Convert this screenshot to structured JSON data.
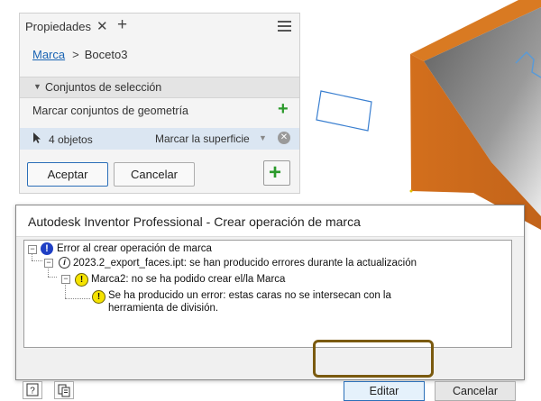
{
  "properties_panel": {
    "tab_label": "Propiedades",
    "breadcrumb": {
      "link": "Marca",
      "current": "Boceto3"
    },
    "section_title": "Conjuntos de selección",
    "mark_geometry_label": "Marcar conjuntos de geometría",
    "selection": {
      "count": "4 objetos",
      "mode": "Marcar la superficie"
    },
    "ok_label": "Aceptar",
    "cancel_label": "Cancelar"
  },
  "dialog": {
    "title": "Autodesk Inventor Professional - Crear operación de marca",
    "tree": [
      {
        "text": "Error al crear operación de marca",
        "icon": "info-blue-icon",
        "level": 0
      },
      {
        "text": "2023.2_export_faces.ipt: se han producido  errores durante la actualización",
        "icon": "info-icon",
        "level": 1
      },
      {
        "text": "Marca2: no se ha podido crear el/la Marca",
        "icon": "warning-icon",
        "level": 2
      },
      {
        "text": "Se ha producido un error: estas caras no se intersecan con la",
        "text2": "herramienta de división.",
        "icon": "warning-icon",
        "level": 3
      }
    ],
    "edit_label": "Editar",
    "cancel_label": "Cancelar"
  },
  "colors": {
    "model_face_orange": "#cc6a1a",
    "model_face_gray": "#8a8a8a",
    "highlight_border": "#7a5a0f",
    "accent_blue": "#2b6fb8"
  }
}
